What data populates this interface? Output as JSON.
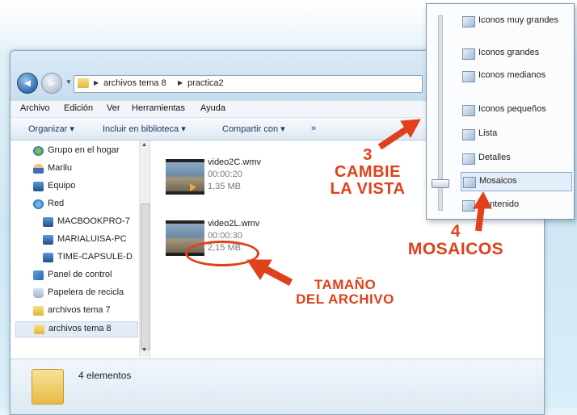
{
  "address_bar": {
    "crumbs": [
      "archivos tema 8",
      "practica2"
    ]
  },
  "menubar": [
    "Archivo",
    "Edición",
    "Ver",
    "Herramientas",
    "Ayuda"
  ],
  "toolbar": {
    "organize": "Organizar ▾",
    "include": "Incluir en biblioteca ▾",
    "share": "Compartir con ▾",
    "more": "»"
  },
  "nav_pane": [
    {
      "label": "Grupo en el hogar",
      "icon": "homegroup-icon"
    },
    {
      "label": "Marilu",
      "icon": "user-icon"
    },
    {
      "label": "Equipo",
      "icon": "computer-icon"
    },
    {
      "label": "Red",
      "icon": "network-icon"
    },
    {
      "label": "MACBOOKPRO-7",
      "icon": "computer-icon"
    },
    {
      "label": "MARIALUISA-PC",
      "icon": "computer-icon"
    },
    {
      "label": "TIME-CAPSULE-D",
      "icon": "computer-icon"
    },
    {
      "label": "Panel de control",
      "icon": "control-panel-icon"
    },
    {
      "label": "Papelera de recicla",
      "icon": "recycle-bin-icon"
    },
    {
      "label": "archivos tema 7",
      "icon": "folder-icon"
    },
    {
      "label": "archivos tema 8",
      "icon": "folder-icon",
      "selected": true
    }
  ],
  "files": [
    {
      "name": "video2C.wmv",
      "duration": "00:00:20",
      "size": "1,35 MB"
    },
    {
      "name": "video2L.wmv",
      "duration": "00:00:30",
      "size": "2,15 MB"
    }
  ],
  "details": {
    "count": "4 elementos"
  },
  "view_menu": [
    {
      "label": "Iconos muy grandes"
    },
    {
      "label": "Iconos grandes"
    },
    {
      "label": "Iconos medianos"
    },
    {
      "label": "Iconos pequeños"
    },
    {
      "label": "Lista"
    },
    {
      "label": "Detalles"
    },
    {
      "label": "Mosaicos",
      "selected": true
    },
    {
      "label": "Contenido"
    }
  ],
  "annotations": {
    "step3_num": "3",
    "step3_line1": "CAMBIE",
    "step3_line2": "LA VISTA",
    "step4_num": "4",
    "step4_line1": "MOSAICOS",
    "size_line1": "TAMAÑO",
    "size_line2": "DEL ARCHIVO"
  },
  "colors": {
    "annotation": "#e0401a",
    "selection": "#e3ecf6"
  }
}
